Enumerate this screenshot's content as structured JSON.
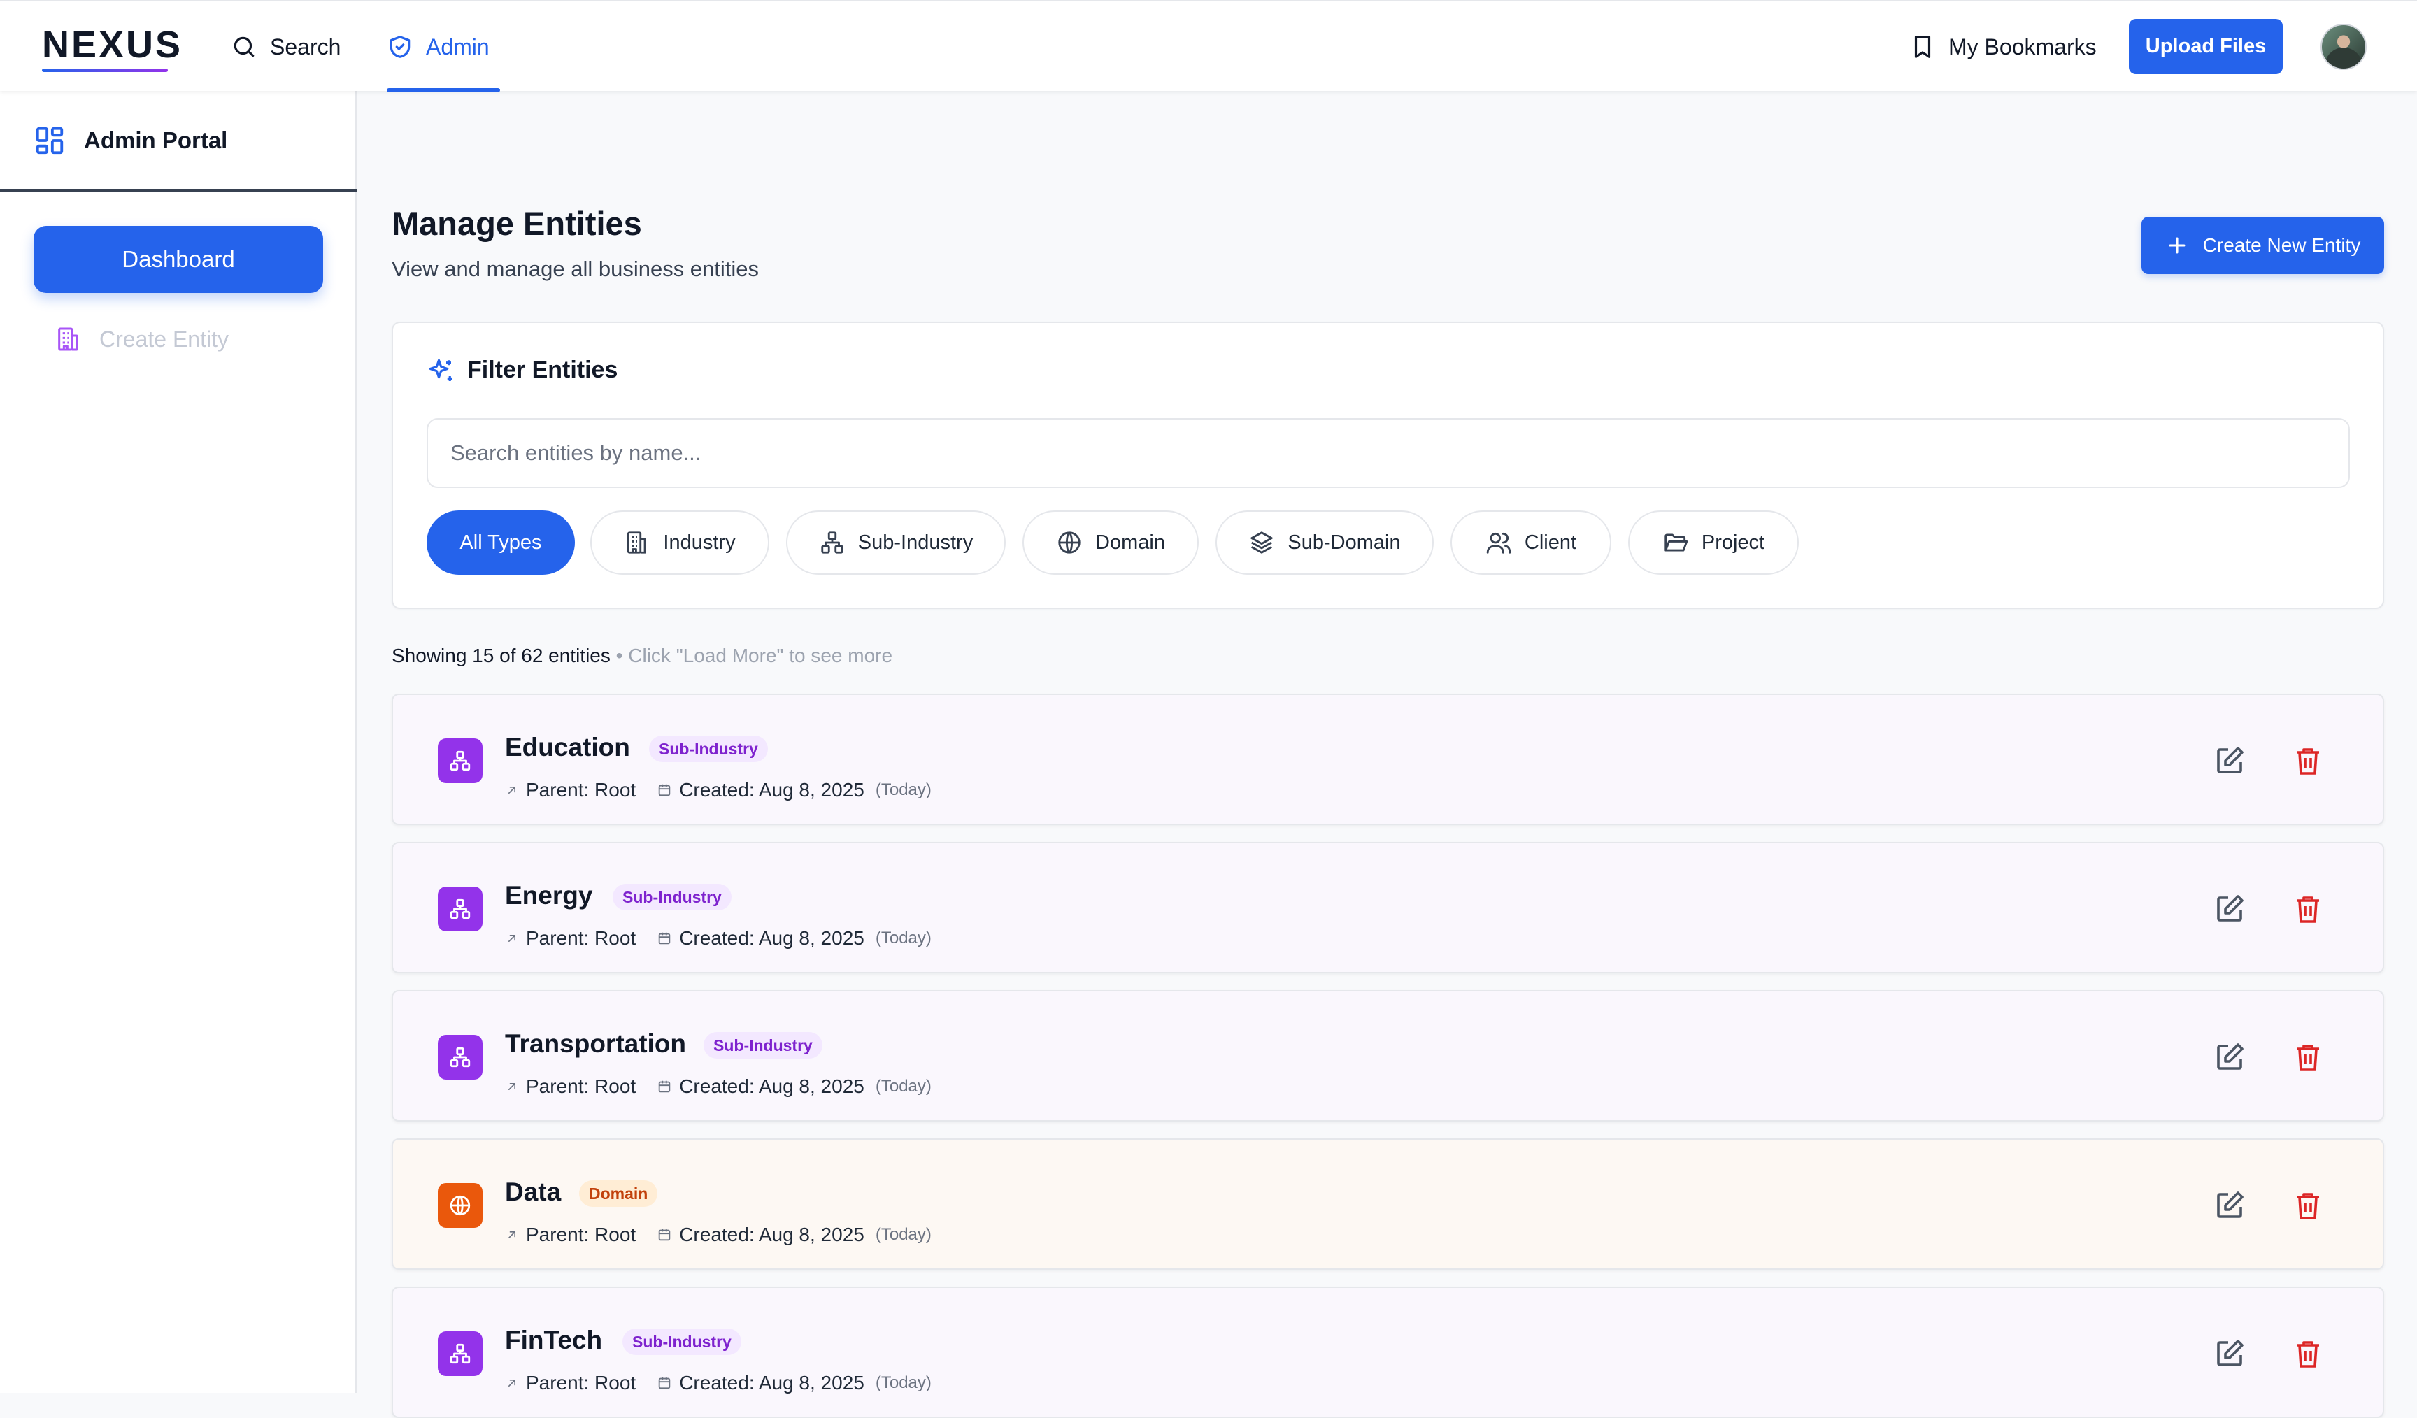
{
  "header": {
    "logo": "NEXUS",
    "nav": [
      {
        "label": "Search",
        "icon": "search-icon"
      },
      {
        "label": "Admin",
        "icon": "shield-check-icon",
        "active": true
      }
    ],
    "bookmarks_label": "My Bookmarks",
    "upload_label": "Upload Files"
  },
  "sidebar": {
    "title": "Admin Portal",
    "items": [
      {
        "label": "Dashboard",
        "active": true
      },
      {
        "label": "Create Entity",
        "icon": "building-icon"
      }
    ]
  },
  "main": {
    "title": "Manage Entities",
    "subtitle": "View and manage all business entities",
    "create_label": "Create New Entity",
    "filter": {
      "title": "Filter Entities",
      "search_placeholder": "Search entities by name...",
      "chips": [
        {
          "label": "All Types",
          "active": true
        },
        {
          "label": "Industry",
          "icon": "building-icon"
        },
        {
          "label": "Sub-Industry",
          "icon": "network-icon"
        },
        {
          "label": "Domain",
          "icon": "globe-icon"
        },
        {
          "label": "Sub-Domain",
          "icon": "layers-icon"
        },
        {
          "label": "Client",
          "icon": "users-icon"
        },
        {
          "label": "Project",
          "icon": "folder-open-icon"
        }
      ]
    },
    "count_text": "Showing 15 of 62 entities",
    "count_hint": " • Click \"Load More\" to see more",
    "entities": [
      {
        "name": "Education",
        "type": "Sub-Industry",
        "parent": "Parent: Root",
        "created": "Created: Aug 8, 2025",
        "relative": "(Today)"
      },
      {
        "name": "Energy",
        "type": "Sub-Industry",
        "parent": "Parent: Root",
        "created": "Created: Aug 8, 2025",
        "relative": "(Today)"
      },
      {
        "name": "Transportation",
        "type": "Sub-Industry",
        "parent": "Parent: Root",
        "created": "Created: Aug 8, 2025",
        "relative": "(Today)"
      },
      {
        "name": "Data",
        "type": "Domain",
        "parent": "Parent: Root",
        "created": "Created: Aug 8, 2025",
        "relative": "(Today)"
      },
      {
        "name": "FinTech",
        "type": "Sub-Industry",
        "parent": "Parent: Root",
        "created": "Created: Aug 8, 2025",
        "relative": "(Today)"
      }
    ]
  },
  "colors": {
    "accent": "#2563eb",
    "sub_industry": "#9333ea",
    "domain": "#ea580c",
    "delete": "#dc2626"
  }
}
